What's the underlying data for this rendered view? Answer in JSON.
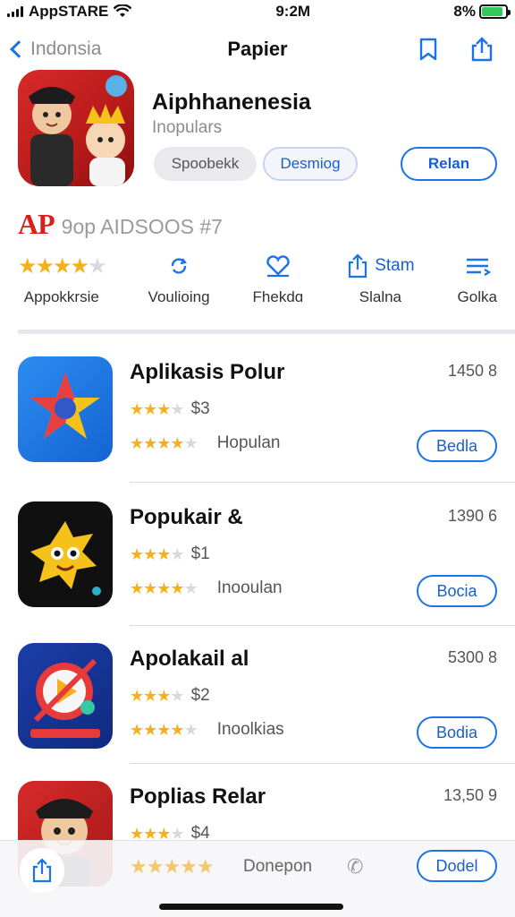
{
  "status": {
    "carrier": "AppSTARE",
    "time": "9:2M",
    "battery": "8%"
  },
  "nav": {
    "back_label": "Indonsia",
    "title": "Papier"
  },
  "hero": {
    "title": "Aiphhanenesia",
    "subtitle": "Inopulars",
    "pill_1": "Spoobekk",
    "pill_2": "Desmiog",
    "primary": "Relan"
  },
  "brand": {
    "logo": "AP",
    "text": "9op AIDSOOS #7"
  },
  "info": [
    {
      "label": "Appokkrsie",
      "icon": "stars"
    },
    {
      "label": "Voulioing",
      "icon": "refresh-icon"
    },
    {
      "label": "Fhekdɑ",
      "icon": "heart-icon"
    },
    {
      "label": "Slalna",
      "icon": "share-icon",
      "icon_text": "Stam"
    },
    {
      "label": "Golka",
      "icon": "list-icon"
    }
  ],
  "apps": [
    {
      "name": "Aplikasis Polur",
      "meta": "1450 8",
      "price": "$3",
      "category": "Hopulan",
      "button": "Bedla",
      "rating": 4.5
    },
    {
      "name": "Popukair &",
      "meta": "1390 6",
      "price": "$1",
      "category": "Inooulan",
      "button": "Bocia",
      "rating": 4.5
    },
    {
      "name": "Apolakail al",
      "meta": "5300 8",
      "price": "$2",
      "category": "Inoolkias",
      "button": "Bodia",
      "rating": 4.5
    },
    {
      "name": "Poplias Relar",
      "meta": "13,50 9",
      "price": "$4",
      "category": "Donepon",
      "button": "Dodel",
      "rating": 4.5
    }
  ],
  "colors": {
    "accent": "#1a73e8",
    "star": "#f5b11b",
    "brand_red": "#d91e1e"
  }
}
